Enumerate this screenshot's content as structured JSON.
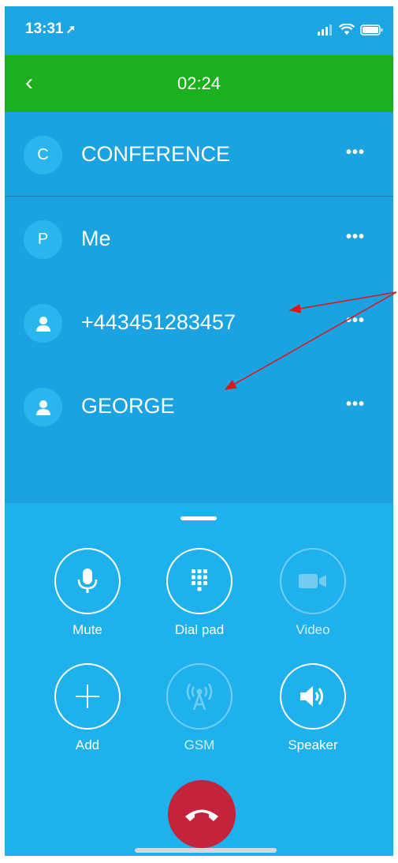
{
  "status_bar": {
    "time": "13:31"
  },
  "header": {
    "call_duration": "02:24"
  },
  "participants": [
    {
      "initial": "C",
      "name": "CONFERENCE",
      "avatar": "letter"
    },
    {
      "initial": "P",
      "name": "Me",
      "avatar": "letter"
    },
    {
      "initial": "",
      "name": "+443451283457",
      "avatar": "person-icon"
    },
    {
      "initial": "",
      "name": "GEORGE",
      "avatar": "person-icon"
    }
  ],
  "more_label": "•••",
  "controls": {
    "mute": "Mute",
    "dialpad": "Dial pad",
    "video": "Video",
    "add": "Add",
    "gsm": "GSM",
    "speaker": "Speaker"
  },
  "colors": {
    "header_green": "#1db01e",
    "background_blue": "#1da6e3",
    "end_call_red": "#c3243b",
    "annotation_arrow": "#e0151a"
  }
}
